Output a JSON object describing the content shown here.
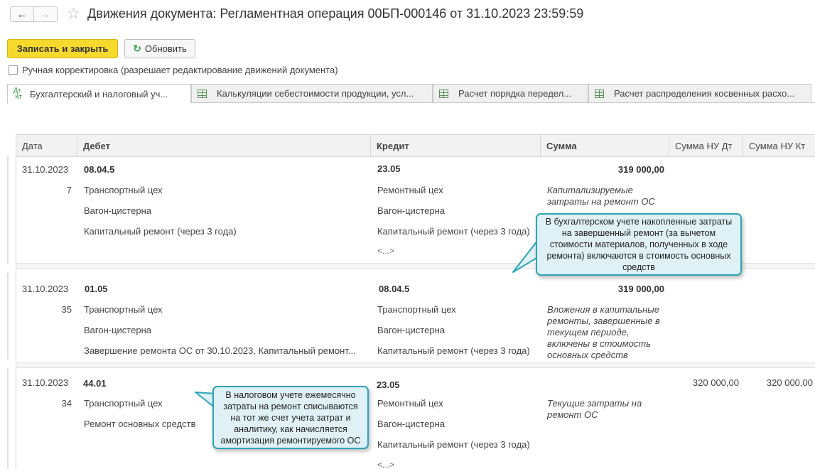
{
  "window": {
    "title": "Движения документа: Регламентная операция 00БП-000146 от 31.10.2023 23:59:59"
  },
  "toolbar": {
    "save_close_label": "Записать и закрыть",
    "refresh_label": "Обновить"
  },
  "manual_correction": {
    "label": "Ручная корректировка (разрешает редактирование движений документа)",
    "checked": false
  },
  "tabs": [
    {
      "label": "Бухгалтерский и налоговый уч...",
      "icon": "dt-kt-icon",
      "active": true
    },
    {
      "label": "Калькуляции себестоимости продукции, усл...",
      "icon": "table-icon",
      "active": false
    },
    {
      "label": "Расчет порядка передел...",
      "icon": "table-icon",
      "active": false
    },
    {
      "label": "Расчет распределения косвенных расхо...",
      "icon": "table-icon",
      "active": false
    }
  ],
  "columns": {
    "date": "Дата",
    "debit": "Дебет",
    "credit": "Кредит",
    "amount": "Сумма",
    "amount_nu_dt": "Сумма НУ Дт",
    "amount_nu_kt": "Сумма НУ Кт"
  },
  "rows": [
    {
      "date": "31.10.2023",
      "num": "7",
      "debit_account": "08.04.5",
      "debit_sub": [
        "Транспортный цех",
        "Вагон-цистерна",
        "Капитальный ремонт (через 3 года)"
      ],
      "credit_account": "23.05",
      "credit_sub": [
        "Ремонтный цех",
        "Вагон-цистерна",
        "Капитальный ремонт (через 3 года)"
      ],
      "credit_more": "<...>",
      "amount": "319 000,00",
      "content": "Капитализируемые затраты на ремонт ОС"
    },
    {
      "date": "31.10.2023",
      "num": "35",
      "debit_account": "01.05",
      "debit_sub": [
        "Транспортный цех",
        "Вагон-цистерна",
        "Завершение ремонта ОС от 30.10.2023, Капитальный ремонт..."
      ],
      "credit_account": "08.04.5",
      "credit_sub": [
        "Транспортный цех",
        "Вагон-цистерна",
        "Капитальный ремонт (через 3 года)"
      ],
      "amount": "319 000,00",
      "content": "Вложения в капитальные ремонты, завершенные в текущем периоде, включены в стоимость основных средств"
    },
    {
      "date": "31.10.2023",
      "num": "34",
      "debit_account": "44.01",
      "debit_sub": [
        "Транспортный цех",
        "Ремонт основных средств"
      ],
      "credit_account": "23.05",
      "credit_sub": [
        "Ремонтный цех",
        "Вагон-цистерна",
        "Капитальный ремонт (через 3 года)"
      ],
      "credit_more": "<...>",
      "amount_nu_dt": "320 000,00",
      "amount_nu_kt": "320 000,00",
      "content": "Текущие затраты на ремонт ОС"
    }
  ],
  "callouts": {
    "accounting": "В бухгалтерском учете накопленные затраты на завершенный ремонт (за вычетом стоимости материалов, полученных в ходе ремонта) включаются в стоимость основных средств",
    "tax": "В налоговом учете ежемесячно затраты на ремонт списываются на тот же счет учета затрат и аналитику, как начисляется амортизация ремонтируемого ОС"
  },
  "colors": {
    "primary_button": "#f7d92e",
    "callout_fill": "#dff1f6",
    "callout_border": "#2ba4b8"
  }
}
